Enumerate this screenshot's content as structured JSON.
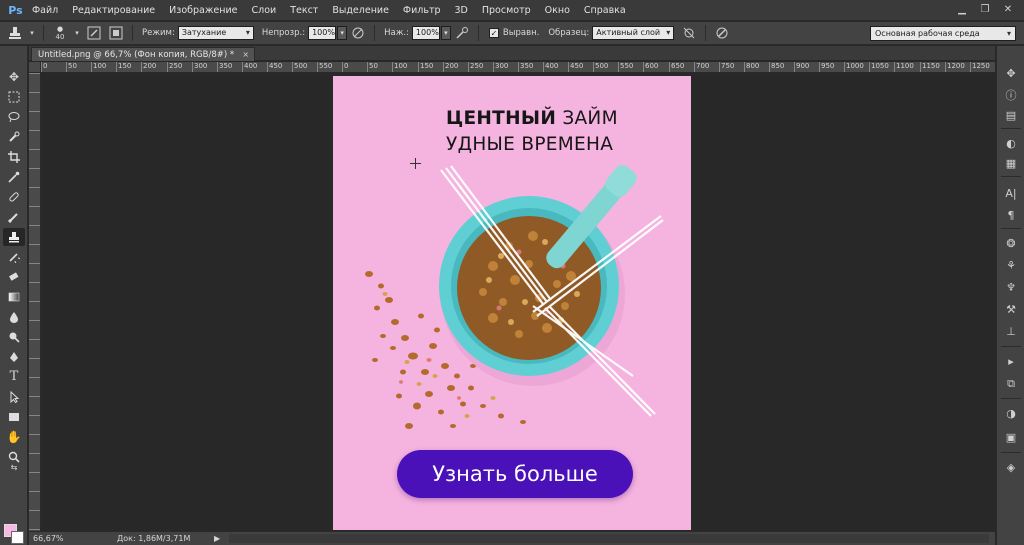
{
  "app": {
    "logo": "Ps"
  },
  "menu": [
    "Файл",
    "Редактирование",
    "Изображение",
    "Слои",
    "Текст",
    "Выделение",
    "Фильтр",
    "3D",
    "Просмотр",
    "Окно",
    "Справка"
  ],
  "window_controls": {
    "minimize": "▁",
    "restore": "❐",
    "close": "✕"
  },
  "options": {
    "brush_size": "40",
    "mode_label": "Режим:",
    "mode_value": "Затухание",
    "opacity_label": "Непрозр.:",
    "opacity_value": "100%",
    "flow_label": "Наж.:",
    "flow_value": "100%",
    "aligned_label": "Выравн.",
    "aligned_checked": "✓",
    "sample_label": "Образец:",
    "sample_value": "Активный слой",
    "workspace": "Основная рабочая среда"
  },
  "document": {
    "tab_title": "Untitled.png @ 66,7% (Фон копия, RGB/8#) *",
    "close": "×"
  },
  "rulers": {
    "h_labels": [
      "0",
      "50",
      "100",
      "150",
      "200",
      "250",
      "300",
      "350",
      "400",
      "450",
      "500",
      "550",
      "0",
      "50",
      "100",
      "150",
      "200",
      "250",
      "300",
      "350",
      "400",
      "450",
      "500",
      "550",
      "600",
      "650",
      "700",
      "750",
      "800",
      "850",
      "900",
      "950",
      "1000",
      "1050",
      "1100",
      "1150",
      "1200",
      "1250"
    ]
  },
  "artboard": {
    "headline_bold": "ЦЕНТНЫЙ",
    "headline_rest": " ЗАЙМ",
    "headline_line2": "УДНЫЕ ВРЕМЕНА",
    "cta": "Узнать больше",
    "background": "#f5b3df",
    "cta_color": "#4a11b8",
    "bowl_color": "#5fcfd3"
  },
  "status": {
    "zoom": "66,67%",
    "doc_info": "Док: 1,86M/3,71M",
    "arrow": "▶"
  },
  "colors": {
    "foreground": "#f7b8e4",
    "background": "#ffffff"
  }
}
